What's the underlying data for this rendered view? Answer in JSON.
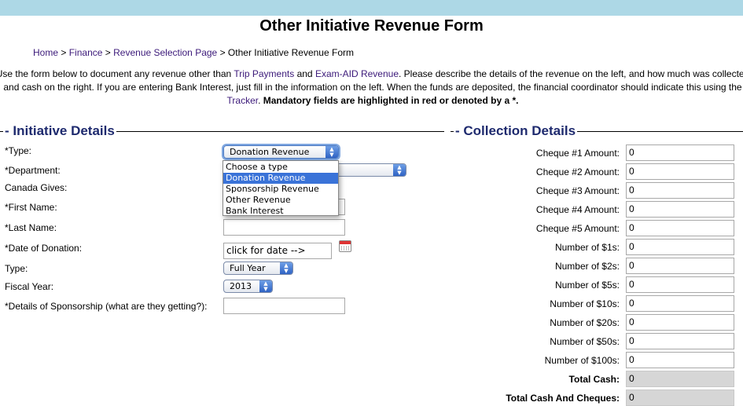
{
  "page": {
    "title": "Other Initiative Revenue Form"
  },
  "breadcrumb": {
    "home": "Home",
    "finance": "Finance",
    "revenue_selection": "Revenue Selection Page",
    "current": "Other Initiative Revenue Form",
    "separator": ">"
  },
  "intro": {
    "line1_a": "Use the form below to document any revenue other than ",
    "link_trip": "Trip Payments",
    "line1_b": " and ",
    "link_exam": "Exam-AID Revenue",
    "line1_c": ". Please describe the details of the revenue on the left, and how much was collected",
    "line2": "and cash on the right. If you are entering Bank Interest, just fill in the information on the left. When the funds are deposited, the financial coordinator should indicate this using the",
    "link_tracker": "Tracker",
    "line3_b": ". ",
    "mandatory_note": "Mandatory fields are highlighted in red or denoted by a *."
  },
  "initiative_details": {
    "legend": "Initiative Details",
    "type_label": "*Type:",
    "type_value": "Donation Revenue",
    "department_label": "*Department:",
    "canada_gives_label": "Canada Gives:",
    "first_name_label": "*First Name:",
    "last_name_label": "*Last Name:",
    "date_label": "*Date of Donation:",
    "date_value": "click for date -->",
    "type2_label": "Type:",
    "type2_value": "Full Year",
    "fiscal_year_label": "Fiscal Year:",
    "fiscal_year_value": "2013",
    "sponsorship_label": "*Details of Sponsorship (what are they getting?):"
  },
  "type_dropdown": {
    "options": [
      "Choose a type",
      "Donation Revenue",
      "Sponsorship Revenue",
      "Other Revenue",
      "Bank Interest"
    ],
    "selected_index": 1
  },
  "collection_details": {
    "legend": "Collection Details",
    "fields": [
      {
        "label": "Cheque #1 Amount:",
        "value": "0"
      },
      {
        "label": "Cheque #2 Amount:",
        "value": "0"
      },
      {
        "label": "Cheque #3 Amount:",
        "value": "0"
      },
      {
        "label": "Cheque #4 Amount:",
        "value": "0"
      },
      {
        "label": "Cheque #5 Amount:",
        "value": "0"
      },
      {
        "label": "Number of $1s:",
        "value": "0"
      },
      {
        "label": "Number of $2s:",
        "value": "0"
      },
      {
        "label": "Number of $5s:",
        "value": "0"
      },
      {
        "label": "Number of $10s:",
        "value": "0"
      },
      {
        "label": "Number of $20s:",
        "value": "0"
      },
      {
        "label": "Number of $50s:",
        "value": "0"
      },
      {
        "label": "Number of $100s:",
        "value": "0"
      },
      {
        "label": "Total Cash:",
        "value": "0"
      },
      {
        "label": "Total Cash And Cheques:",
        "value": "0"
      }
    ]
  },
  "colors": {
    "top_bar": "#add8e6",
    "link": "#3c1a7a",
    "legend": "#1e2a6e",
    "selected_option": "#3a73d8"
  },
  "icons": {
    "calendar": "calendar-icon",
    "select_arrows": "updown-arrows-icon"
  }
}
